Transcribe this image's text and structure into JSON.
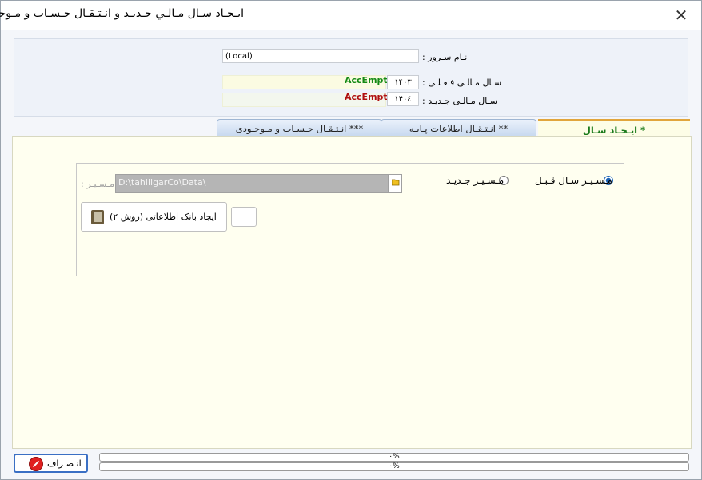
{
  "window": {
    "title": "ايـجـاد سـال مـالـي جـديـد و انـتـقـال حـسـاب و مـوجـودي",
    "close_label": "✕"
  },
  "server": {
    "label": "نـام سـرور :",
    "value": "(Local)"
  },
  "current_year": {
    "label": "سـال مـالـی فـعـلـی :",
    "value": "۱۴۰۳",
    "db": "AccEmpty",
    "db_color": "#148a14"
  },
  "new_year": {
    "label": "سـال مـالـی جـدیـد :",
    "value": "۱۴۰٤",
    "db": "AccEmpty",
    "db_color": "#b01010"
  },
  "tabs": [
    {
      "label": "* ایـجـاد سـال",
      "active": true
    },
    {
      "label": "** انـتـقـال اطلاعات پـایـه",
      "active": false
    },
    {
      "label": "*** انـتـقـال حـسـاب و مـوجـودی",
      "active": false
    }
  ],
  "path_options": {
    "prev_year_label": "مـسـیـر سـال قـبـل",
    "new_path_label": "مـسـیـر جـدیـد",
    "selected": "prev_year"
  },
  "path": {
    "label": "مـسـیـر :",
    "value": "D:\\tahlilgarCo\\Data\\",
    "folder_icon": "folder-open-icon"
  },
  "create_db_button": {
    "label": "ایجاد بانک اطلاعاتی (روش ۲)",
    "icon": "database-door-icon"
  },
  "progress": [
    {
      "text": "۰%",
      "value": 0
    },
    {
      "text": "۰%",
      "value": 0
    }
  ],
  "cancel_button": {
    "label": "انـصـراف",
    "icon": "cancel-icon"
  }
}
